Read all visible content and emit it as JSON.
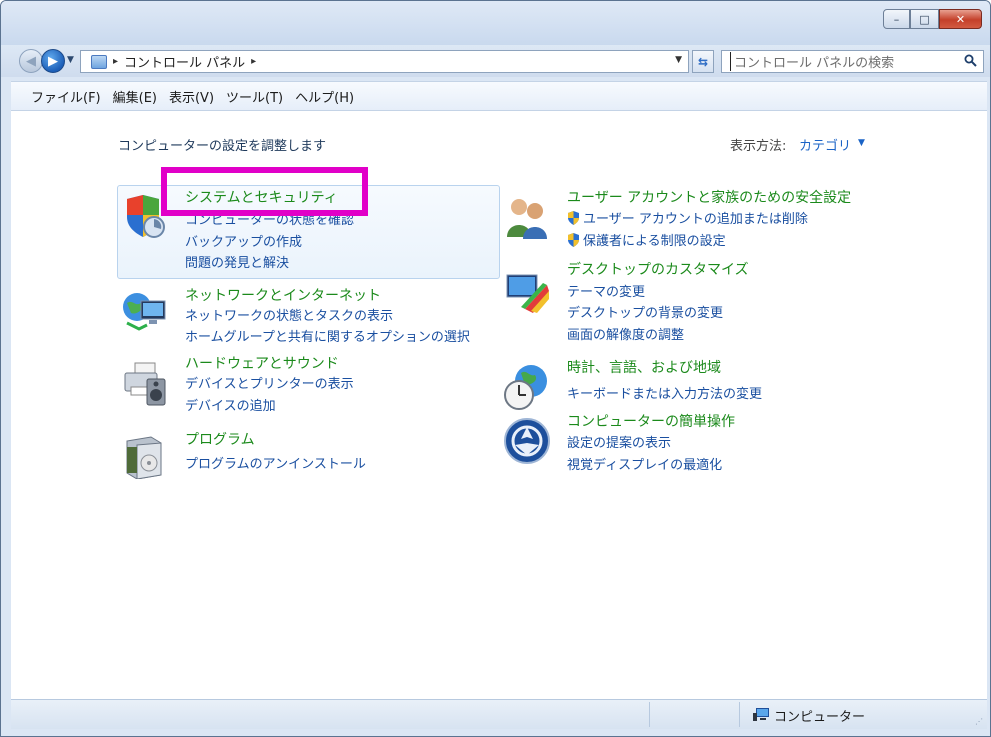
{
  "window": {
    "title": ""
  },
  "window_buttons": {
    "minimize": "–",
    "maximize": "□",
    "close": "✕"
  },
  "address": {
    "separator": "▸",
    "path": "コントロール パネル",
    "separator_end": "▸"
  },
  "search": {
    "placeholder": "コントロール パネルの検索"
  },
  "menu": [
    "ファイル(F)",
    "編集(E)",
    "表示(V)",
    "ツール(T)",
    "ヘルプ(H)"
  ],
  "content": {
    "intro": "コンピューターの設定を調整します",
    "view_by_label": "表示方法:",
    "view_by_value": "カテゴリ"
  },
  "categories": {
    "system": {
      "title": "システムとセキュリティ",
      "links": [
        "コンピューターの状態を確認",
        "バックアップの作成",
        "問題の発見と解決"
      ]
    },
    "network": {
      "title": "ネットワークとインターネット",
      "links": [
        "ネットワークの状態とタスクの表示",
        "ホームグループと共有に関するオプションの選択"
      ]
    },
    "hardware": {
      "title": "ハードウェアとサウンド",
      "links": [
        "デバイスとプリンターの表示",
        "デバイスの追加"
      ]
    },
    "programs": {
      "title": "プログラム",
      "links": [
        "プログラムのアンインストール"
      ]
    },
    "users": {
      "title": "ユーザー アカウントと家族のための安全設定",
      "links": [
        "ユーザー アカウントの追加または削除",
        "保護者による制限の設定"
      ]
    },
    "appearance": {
      "title": "デスクトップのカスタマイズ",
      "links": [
        "テーマの変更",
        "デスクトップの背景の変更",
        "画面の解像度の調整"
      ]
    },
    "clock": {
      "title": "時計、言語、および地域",
      "links": [
        "キーボードまたは入力方法の変更"
      ]
    },
    "ease": {
      "title": "コンピューターの簡単操作",
      "links": [
        "設定の提案の表示",
        "視覚ディスプレイの最適化"
      ]
    }
  },
  "status": {
    "text": "コンピューター"
  },
  "colors": {
    "link": "#1a4fa0",
    "category_title": "#1b8a1b",
    "highlight": "#e100c8"
  }
}
